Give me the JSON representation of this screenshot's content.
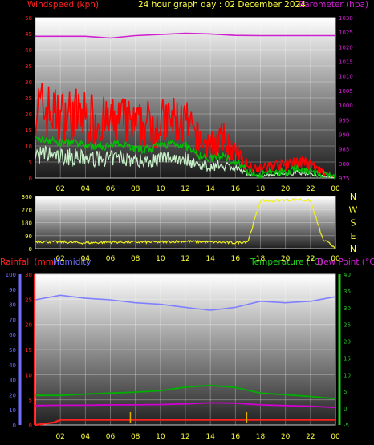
{
  "header": {
    "left": "Windspeed (kph)",
    "center": "24 hour graph day : 02 December 2024",
    "right": "Barometer (hpa)"
  },
  "colors": {
    "wind_axis": "#ff2020",
    "baro_axis": "#d020d0",
    "title": "#ffff40",
    "rain_axis": "#ff2020",
    "humidity_axis": "#7070ff",
    "temp_axis": "#20d020",
    "dew_axis": "#d020d0",
    "direction_line": "#f0f020",
    "gust": "#ff0000",
    "avg_wind": "#00c000",
    "wind_light": "#c8f0c8",
    "humidity_line": "#8080ff",
    "temp_line": "#00b000",
    "dew_line": "#d000d0",
    "rain_line": "#ff2020",
    "rain_bar": "#e0b000"
  },
  "chart_data": [
    {
      "type": "line",
      "title": "24 hour graph day : 02 December 2024",
      "ylabel": "Windspeed (kph)",
      "y2label": "Barometer (hpa)",
      "xticks": [
        "02",
        "04",
        "06",
        "08",
        "10",
        "12",
        "14",
        "16",
        "18",
        "20",
        "22",
        "00"
      ],
      "ylim": [
        0,
        50
      ],
      "yticks": [
        0,
        5,
        10,
        15,
        20,
        25,
        30,
        35,
        40,
        45,
        50
      ],
      "y2lim": [
        975,
        1030
      ],
      "y2ticks": [
        975,
        980,
        985,
        990,
        995,
        1000,
        1005,
        1010,
        1015,
        1020,
        1025,
        1030
      ],
      "grid": true,
      "series": [
        {
          "role": "gust",
          "axis": "left",
          "x": [
            0,
            1,
            2,
            3,
            4,
            5,
            6,
            7,
            8,
            9,
            10,
            11,
            12,
            13,
            14,
            15,
            16,
            17,
            18,
            19,
            20,
            21,
            22,
            23,
            24
          ],
          "values": [
            22,
            21,
            19,
            20,
            19,
            18,
            17,
            18,
            16,
            17,
            17,
            18,
            17,
            12,
            10,
            12,
            8,
            4,
            3,
            4,
            4,
            5,
            4,
            2,
            0
          ]
        },
        {
          "role": "avg",
          "axis": "left",
          "x": [
            0,
            1,
            2,
            3,
            4,
            5,
            6,
            7,
            8,
            9,
            10,
            11,
            12,
            13,
            14,
            15,
            16,
            17,
            18,
            19,
            20,
            21,
            22,
            23,
            24
          ],
          "values": [
            12,
            12,
            11,
            11,
            10,
            10,
            10,
            11,
            9,
            9,
            10,
            11,
            10,
            7,
            6,
            7,
            5,
            2,
            1,
            2,
            2,
            3,
            2,
            1,
            0
          ]
        },
        {
          "role": "barometer",
          "axis": "right",
          "x": [
            0,
            2,
            4,
            6,
            8,
            10,
            12,
            14,
            16,
            18,
            20,
            22,
            24
          ],
          "values": [
            1023.6,
            1023.6,
            1023.6,
            1023.0,
            1023.8,
            1024.2,
            1024.6,
            1024.4,
            1023.9,
            1023.8,
            1023.8,
            1023.8,
            1023.8
          ]
        }
      ]
    },
    {
      "type": "line",
      "xticks": [
        "02",
        "04",
        "06",
        "08",
        "10",
        "12",
        "14",
        "16",
        "18",
        "20",
        "22",
        "00"
      ],
      "ylim": [
        0,
        360
      ],
      "yticks": [
        0,
        90,
        180,
        270,
        360
      ],
      "compass": [
        "N",
        "W",
        "S",
        "E",
        "N"
      ],
      "grid": true,
      "series": [
        {
          "role": "wind_direction",
          "x": [
            0,
            2,
            4,
            6,
            8,
            10,
            11,
            12,
            14,
            16,
            17,
            18,
            19,
            20,
            21,
            22,
            23,
            24
          ],
          "values": [
            50,
            45,
            40,
            45,
            45,
            45,
            50,
            50,
            45,
            40,
            50,
            330,
            330,
            335,
            340,
            330,
            60,
            10
          ]
        }
      ]
    },
    {
      "type": "line",
      "xticks": [
        "02",
        "04",
        "06",
        "08",
        "10",
        "12",
        "14",
        "16",
        "18",
        "20",
        "22",
        "00"
      ],
      "y_rain_label": "Rainfall (mm)",
      "y_humidity_label": "Humidity",
      "y_temp_label": "Temperature (°C)",
      "y_dew_label": "Dew Point (°C)",
      "rain_lim": [
        0,
        30
      ],
      "rain_ticks": [
        0,
        5,
        10,
        15,
        20,
        25,
        30
      ],
      "humidity_lim": [
        0,
        100
      ],
      "humidity_ticks": [
        0,
        10,
        20,
        30,
        40,
        50,
        60,
        70,
        80,
        90,
        100
      ],
      "temp_lim": [
        -5,
        40
      ],
      "temp_ticks": [
        -5,
        0,
        5,
        10,
        15,
        20,
        25,
        30,
        35,
        40
      ],
      "grid": true,
      "series": [
        {
          "role": "humidity",
          "axis": "humidity",
          "x": [
            0,
            2,
            4,
            6,
            8,
            10,
            12,
            14,
            16,
            18,
            20,
            22,
            24
          ],
          "values": [
            83,
            86,
            84,
            83,
            81,
            80,
            78,
            76,
            78,
            82,
            81,
            82,
            85
          ]
        },
        {
          "role": "temperature",
          "axis": "temp",
          "x": [
            0,
            2,
            4,
            6,
            8,
            10,
            12,
            14,
            16,
            18,
            20,
            22,
            24
          ],
          "values": [
            3.8,
            3.8,
            4.2,
            4.5,
            4.8,
            5.2,
            6.3,
            6.8,
            6.2,
            4.5,
            4.0,
            3.5,
            2.8
          ]
        },
        {
          "role": "dew_point",
          "axis": "temp",
          "x": [
            0,
            2,
            4,
            6,
            8,
            10,
            12,
            14,
            16,
            18,
            20,
            22,
            24
          ],
          "values": [
            0.8,
            0.9,
            0.9,
            1.0,
            1.0,
            1.1,
            1.3,
            1.6,
            1.5,
            1.0,
            0.8,
            0.6,
            0.2
          ]
        },
        {
          "role": "rainfall",
          "axis": "rain",
          "x": [
            0,
            1.5,
            2,
            24
          ],
          "values": [
            0,
            0.5,
            1.0,
            1.0
          ]
        }
      ]
    }
  ]
}
